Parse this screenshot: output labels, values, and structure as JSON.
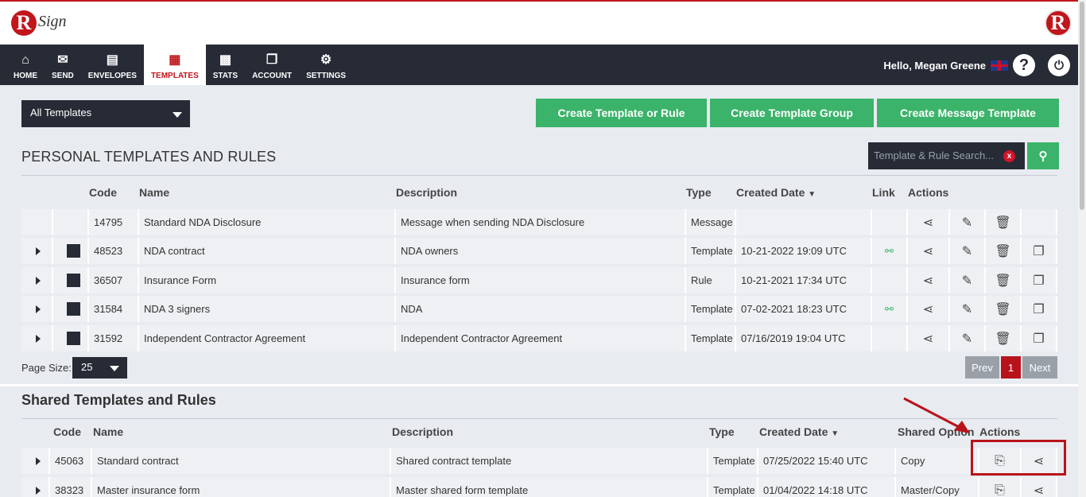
{
  "brand": {
    "logo_letter": "R",
    "logo_text": "Sign",
    "accent": "#c0161c",
    "green": "#3bb36a",
    "dark": "#262b36"
  },
  "nav": {
    "items": [
      {
        "label": "HOME",
        "icon": "home-icon",
        "glyph": "⌂"
      },
      {
        "label": "SEND",
        "icon": "envelope-icon",
        "glyph": "✉"
      },
      {
        "label": "ENVELOPES",
        "icon": "inbox-icon",
        "glyph": "▤"
      },
      {
        "label": "TEMPLATES",
        "icon": "templates-icon",
        "glyph": "▦"
      },
      {
        "label": "STATS",
        "icon": "briefcase-icon",
        "glyph": "▩"
      },
      {
        "label": "ACCOUNT",
        "icon": "document-icon",
        "glyph": "❐"
      },
      {
        "label": "SETTINGS",
        "icon": "gear-icon",
        "glyph": "⚙"
      }
    ],
    "active": "TEMPLATES"
  },
  "user": {
    "greeting": "Hello, Megan Greene",
    "help": "?",
    "power": "⏻"
  },
  "filter": {
    "selected": "All Templates"
  },
  "actions": {
    "create_template_or_rule": "Create Template or Rule",
    "create_template_group": "Create Template Group",
    "create_message_template": "Create Message Template"
  },
  "personal": {
    "title": "PERSONAL TEMPLATES AND RULES",
    "search_placeholder": "Template & Rule Search...",
    "columns": {
      "code": "Code",
      "name": "Name",
      "description": "Description",
      "type": "Type",
      "created": "Created Date",
      "link": "Link",
      "actions": "Actions"
    },
    "rows": [
      {
        "code": "14795",
        "name": "Standard NDA Disclosure",
        "description": "Message when sending NDA Disclosure",
        "type": "Message",
        "created": "",
        "link": false,
        "expandable": false
      },
      {
        "code": "48523",
        "name": "NDA contract",
        "description": "NDA owners",
        "type": "Template",
        "created": "10-21-2022 19:09 UTC",
        "link": true,
        "expandable": true
      },
      {
        "code": "36507",
        "name": "Insurance Form",
        "description": "Insurance form",
        "type": "Rule",
        "created": "10-21-2021 17:34 UTC",
        "link": false,
        "expandable": true
      },
      {
        "code": "31584",
        "name": "NDA 3 signers",
        "description": "NDA",
        "type": "Template",
        "created": "07-02-2021 18:23 UTC",
        "link": true,
        "expandable": true
      },
      {
        "code": "31592",
        "name": "Independent Contractor Agreement",
        "description": "Independent Contractor Agreement",
        "type": "Template",
        "created": "07/16/2019 19:04 UTC",
        "link": false,
        "expandable": true
      }
    ],
    "page_size_label": "Page Size:",
    "page_size": "25",
    "pagination": {
      "prev": "Prev",
      "current": "1",
      "next": "Next"
    }
  },
  "shared": {
    "title": "Shared Templates and Rules",
    "columns": {
      "code": "Code",
      "name": "Name",
      "description": "Description",
      "type": "Type",
      "created": "Created Date",
      "shared_option": "Shared Option",
      "actions": "Actions"
    },
    "rows": [
      {
        "code": "45063",
        "name": "Standard contract",
        "description": "Shared contract template",
        "type": "Template",
        "created": "07/25/2022 15:40 UTC",
        "shared_option": "Copy"
      },
      {
        "code": "38323",
        "name": "Master insurance form",
        "description": "Master shared form template",
        "type": "Template",
        "created": "01/04/2022 14:18 UTC",
        "shared_option": "Master/Copy"
      }
    ]
  }
}
